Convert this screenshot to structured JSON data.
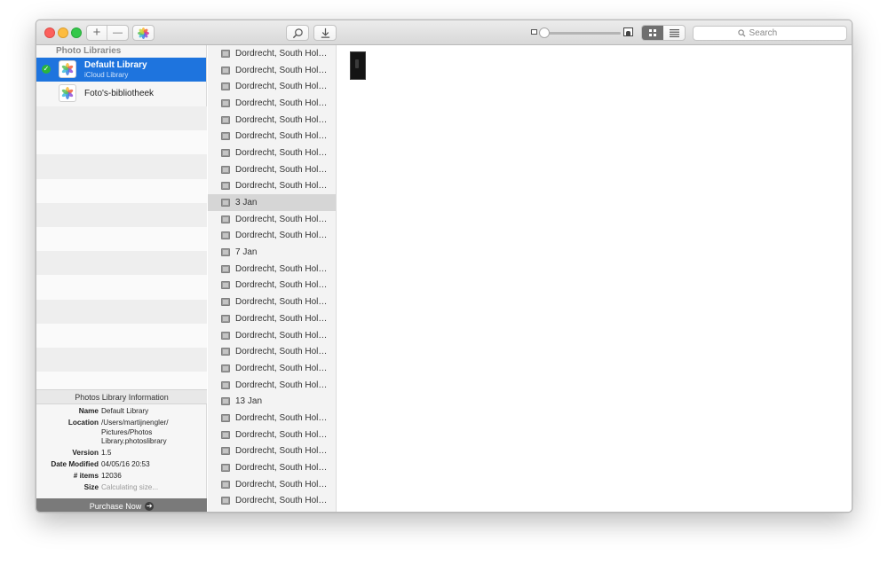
{
  "toolbar": {
    "add_label": "+",
    "remove_label": "—",
    "search_placeholder": "Search"
  },
  "sidebar": {
    "header": "Photo Libraries",
    "libraries": [
      {
        "name": "Default Library",
        "subtitle": "iCloud Library",
        "selected": true
      },
      {
        "name": "Foto's-bibliotheek",
        "subtitle": "",
        "selected": false
      }
    ]
  },
  "info": {
    "title": "Photos Library Information",
    "rows": [
      {
        "label": "Name",
        "value": "Default Library"
      },
      {
        "label": "Location",
        "value": "/Users/martijnengler/ Pictures/Photos Library.photoslibrary"
      },
      {
        "label": "Version",
        "value": "1.5"
      },
      {
        "label": "Date Modified",
        "value": "04/05/16 20:53"
      },
      {
        "label": "# items",
        "value": "12036"
      },
      {
        "label": "Size",
        "value": "Calculating size..."
      }
    ],
    "purchase_label": "Purchase Now"
  },
  "albums": [
    "Dordrecht, South Holland",
    "Dordrecht, South Holland",
    "Dordrecht, South Holland",
    "Dordrecht, South Holland",
    "Dordrecht, South Holland",
    "Dordrecht, South Holland",
    "Dordrecht, South Holland",
    "Dordrecht, South Holland",
    "Dordrecht, South Holland",
    "3 Jan",
    "Dordrecht, South Holland",
    "Dordrecht, South Holland",
    "7 Jan",
    "Dordrecht, South Holland",
    "Dordrecht, South Holland",
    "Dordrecht, South Holland",
    "Dordrecht, South Holland",
    "Dordrecht, South Holland",
    "Dordrecht, South Holland",
    "Dordrecht, South Holland",
    "Dordrecht, South Holland",
    "13 Jan",
    "Dordrecht, South Holland",
    "Dordrecht, South Holland",
    "Dordrecht, South Holland",
    "Dordrecht, South Holland",
    "Dordrecht, South Holland",
    "Dordrecht, South Holland"
  ],
  "selected_album_index": 9,
  "colors": {
    "selection_blue": "#1e74de",
    "check_green": "#2bb43d"
  }
}
